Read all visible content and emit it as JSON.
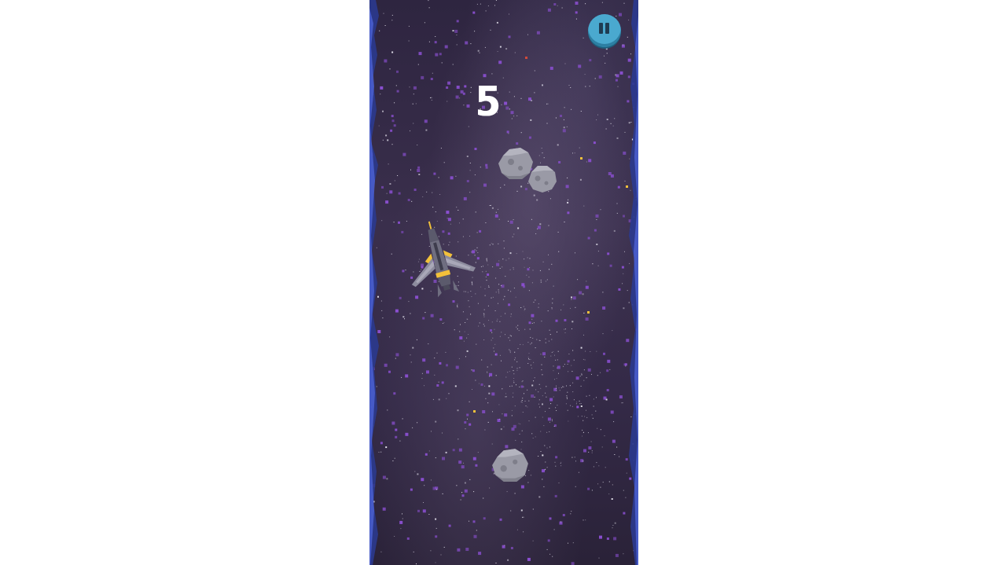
{
  "game": {
    "score": "5",
    "paused": false
  },
  "icons": {
    "pause": "pause-icon",
    "ship": "spaceship-icon",
    "asteroid": "asteroid-icon"
  },
  "colors": {
    "background": "#332a45",
    "stars_purple": "#8a4fd0",
    "stars_white": "#e8e6f0",
    "edge_blue": "#3b4fbf",
    "pause_button": "#4aa9cf",
    "ship_body": "#6f6e80",
    "ship_accent": "#f2c13a",
    "asteroid": "#9a9aa6"
  }
}
